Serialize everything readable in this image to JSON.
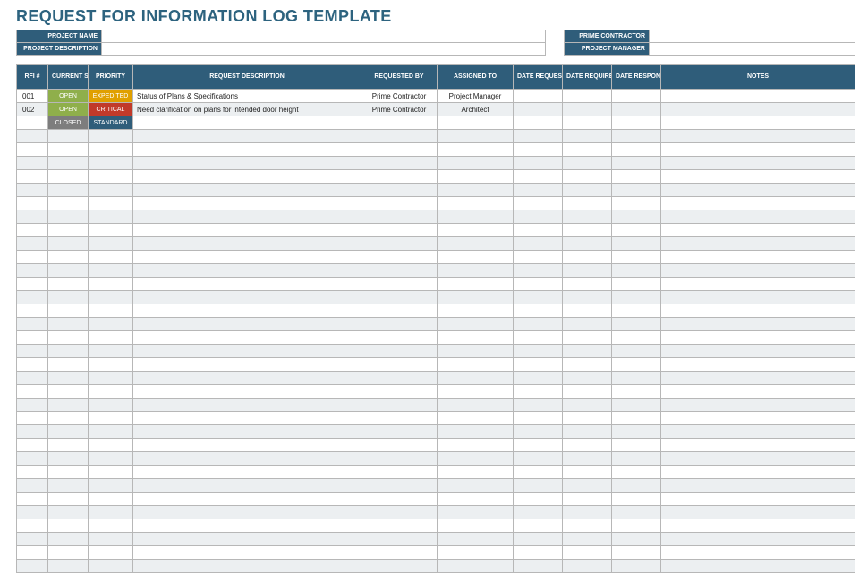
{
  "title": "REQUEST FOR INFORMATION LOG TEMPLATE",
  "meta": {
    "left": [
      {
        "label": "PROJECT NAME",
        "value": ""
      },
      {
        "label": "PROJECT DESCRIPTION",
        "value": ""
      }
    ],
    "right": [
      {
        "label": "PRIME CONTRACTOR",
        "value": ""
      },
      {
        "label": "PROJECT MANAGER",
        "value": ""
      }
    ]
  },
  "columns": [
    "RFI #",
    "CURRENT STATUS",
    "PRIORITY",
    "REQUEST DESCRIPTION",
    "REQUESTED BY",
    "ASSIGNED TO",
    "DATE REQUESTED",
    "DATE REQUIRED",
    "DATE RESPONDED",
    "NOTES"
  ],
  "rows": [
    {
      "rfi": "001",
      "status": "OPEN",
      "priority": "EXPEDITED",
      "desc": "Status of Plans & Specifications",
      "req_by": "Prime Contractor",
      "assigned": "Project Manager",
      "d_req": "",
      "d_reqd": "",
      "d_resp": "",
      "notes": ""
    },
    {
      "rfi": "002",
      "status": "OPEN",
      "priority": "CRITICAL",
      "desc": "Need clarification on plans for intended door height",
      "req_by": "Prime Contractor",
      "assigned": "Architect",
      "d_req": "",
      "d_reqd": "",
      "d_resp": "",
      "notes": ""
    },
    {
      "rfi": "",
      "status": "CLOSED",
      "priority": "STANDARD",
      "desc": "",
      "req_by": "",
      "assigned": "",
      "d_req": "",
      "d_reqd": "",
      "d_resp": "",
      "notes": ""
    }
  ],
  "empty_row_count": 33,
  "colors": {
    "header_bg": "#2f5d7a",
    "title": "#2d637f",
    "alt_row": "#eceff1",
    "status": {
      "OPEN": "#8faf4b",
      "CLOSED": "#7d7d7d"
    },
    "priority": {
      "EXPEDITED": "#e0a000",
      "CRITICAL": "#c13a2a",
      "STANDARD": "#2f5d7a"
    }
  }
}
